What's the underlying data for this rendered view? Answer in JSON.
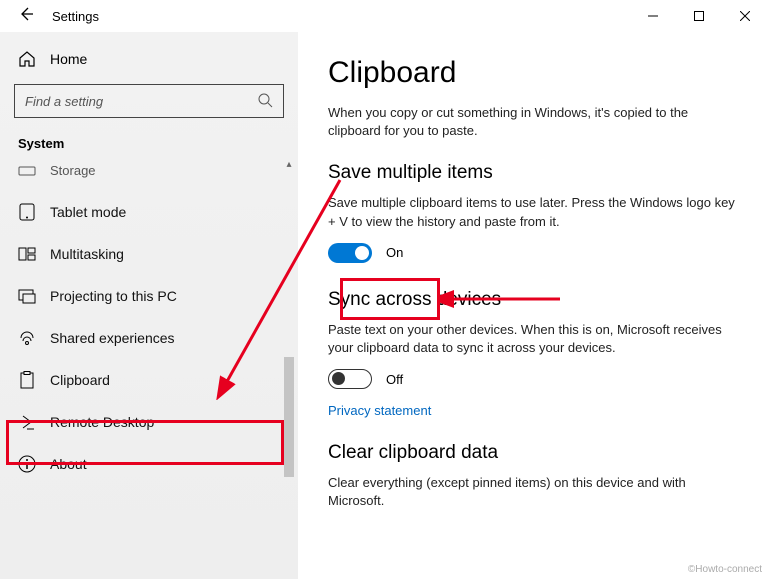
{
  "window": {
    "title": "Settings"
  },
  "sidebar": {
    "home": "Home",
    "search_placeholder": "Find a setting",
    "section": "System",
    "items": [
      {
        "label": "Storage"
      },
      {
        "label": "Tablet mode"
      },
      {
        "label": "Multitasking"
      },
      {
        "label": "Projecting to this PC"
      },
      {
        "label": "Shared experiences"
      },
      {
        "label": "Clipboard"
      },
      {
        "label": "Remote Desktop"
      },
      {
        "label": "About"
      }
    ]
  },
  "main": {
    "title": "Clipboard",
    "intro": "When you copy or cut something in Windows, it's copied to the clipboard for you to paste.",
    "section1": {
      "heading": "Save multiple items",
      "desc": "Save multiple clipboard items to use later. Press the Windows logo key + V to view the history and paste from it.",
      "state": "On"
    },
    "section2": {
      "heading": "Sync across devices",
      "desc": "Paste text on your other devices. When this is on, Microsoft receives your clipboard data to sync it across your devices.",
      "state": "Off",
      "link": "Privacy statement"
    },
    "section3": {
      "heading": "Clear clipboard data",
      "desc": "Clear everything (except pinned items) on this device and with Microsoft."
    }
  },
  "watermark": "©Howto-connect"
}
